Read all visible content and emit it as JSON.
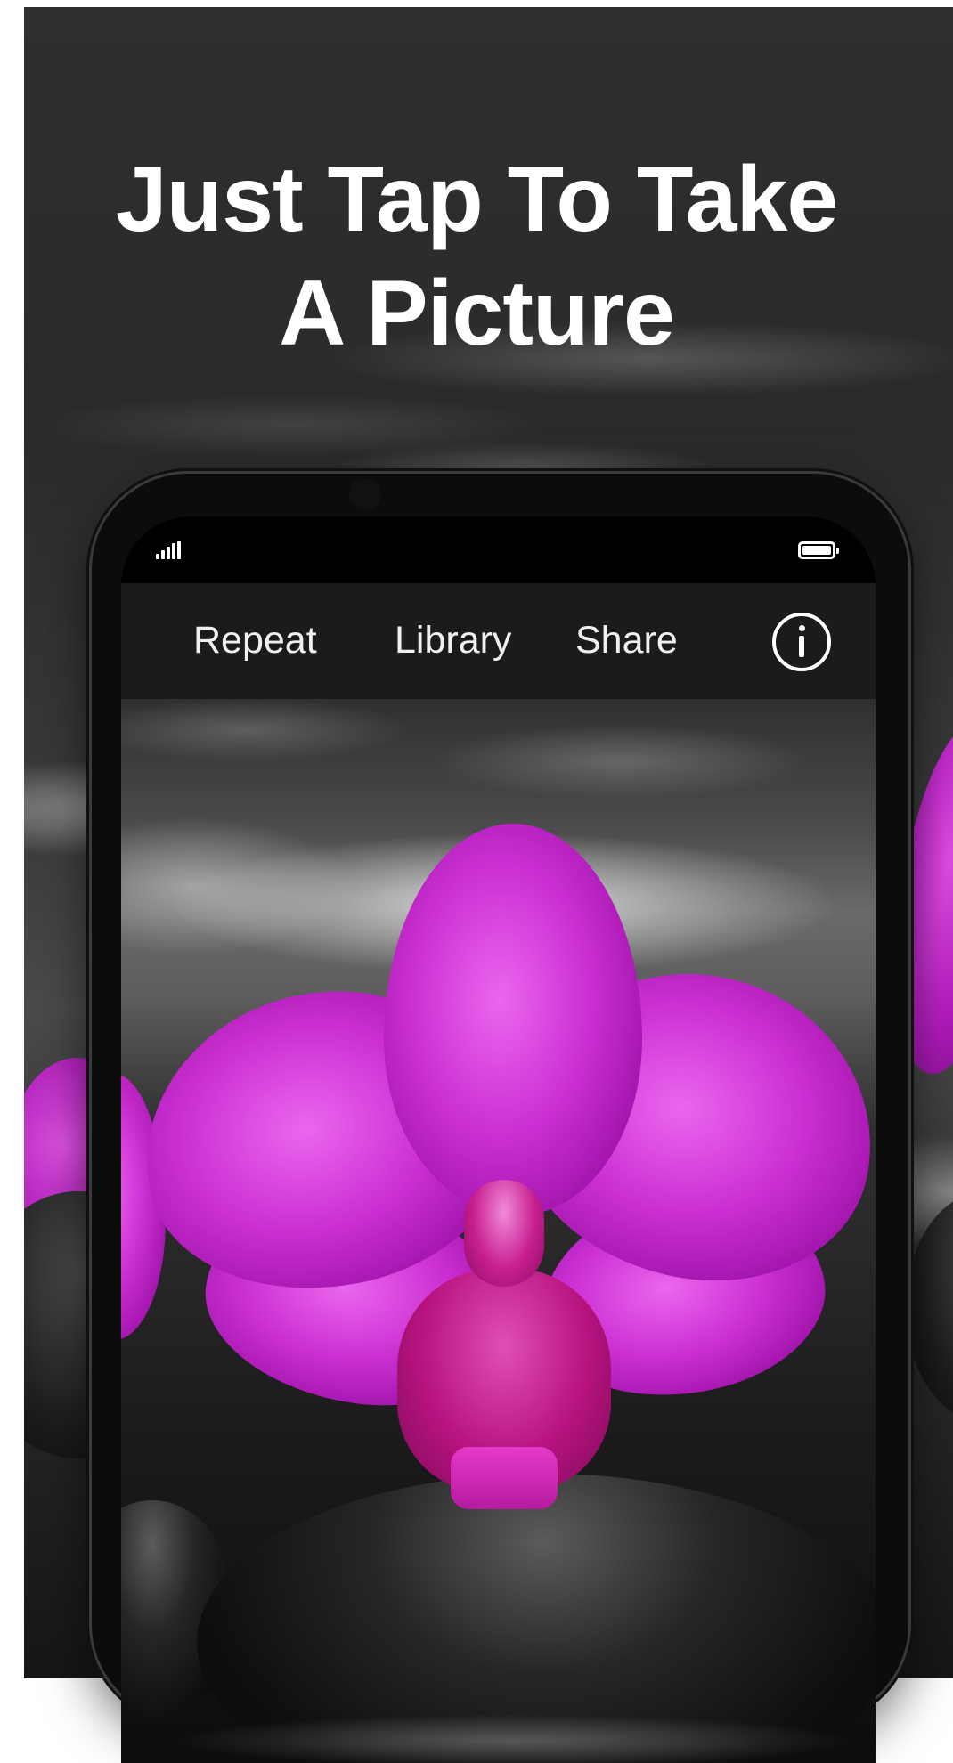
{
  "headline": {
    "line1": "Just Tap To Take",
    "line2": "A Picture"
  },
  "status_bar": {
    "signal_icon": "cellular-signal-icon",
    "battery_icon": "battery-full-icon"
  },
  "toolbar": {
    "repeat_label": "Repeat",
    "library_label": "Library",
    "share_label": "Share",
    "info_icon": "info-circle-icon"
  },
  "colors": {
    "background": "#2f2f30",
    "toolbar": "#1b1b1c",
    "text": "#ffffff",
    "orchid": "#cb2fd2"
  }
}
